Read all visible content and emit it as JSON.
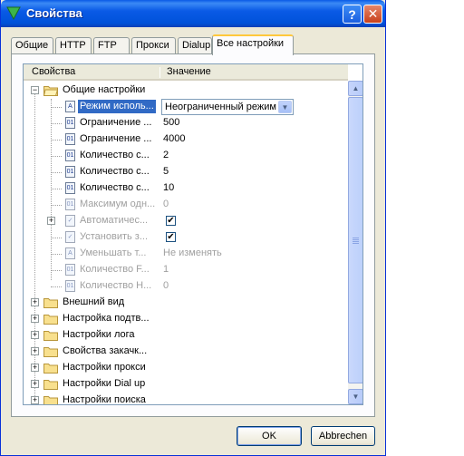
{
  "window": {
    "title": "Свойства",
    "icon": "v-triangle-icon"
  },
  "title_buttons": {
    "help": "?",
    "close": "✕"
  },
  "tabs": [
    {
      "label": "Общие",
      "active": false
    },
    {
      "label": "HTTP",
      "active": false
    },
    {
      "label": "FTP",
      "active": false
    },
    {
      "label": "Прокси",
      "active": false
    },
    {
      "label": "Dialup",
      "active": false
    },
    {
      "label": "Все настройки",
      "active": true
    }
  ],
  "grid": {
    "col_property": "Свойства",
    "col_value": "Значение",
    "rows": [
      {
        "label": "Общие настройки",
        "value": "",
        "kind": "group-open"
      },
      {
        "label": "Режим исполь...",
        "value": "Неограниченный режим",
        "kind": "dropdown"
      },
      {
        "label": "Ограничение ...",
        "value": "500",
        "kind": "num"
      },
      {
        "label": "Ограничение ...",
        "value": "4000",
        "kind": "num"
      },
      {
        "label": "Количество с...",
        "value": "2",
        "kind": "num"
      },
      {
        "label": "Количество с...",
        "value": "5",
        "kind": "num"
      },
      {
        "label": "Количество с...",
        "value": "10",
        "kind": "num"
      },
      {
        "label": "Максимум одн...",
        "value": "0",
        "kind": "num-disabled"
      },
      {
        "label": "Автоматичес...",
        "value": "checked",
        "kind": "bool-disabled-expandable"
      },
      {
        "label": "Установить з...",
        "value": "checked",
        "kind": "bool-disabled"
      },
      {
        "label": "Уменьшать т...",
        "value": "Не изменять",
        "kind": "text-disabled"
      },
      {
        "label": "Количество F...",
        "value": "1",
        "kind": "num-disabled"
      },
      {
        "label": "Количество Н...",
        "value": "0",
        "kind": "num-disabled"
      },
      {
        "label": "Внешний вид",
        "value": "",
        "kind": "group"
      },
      {
        "label": "Настройка подтв...",
        "value": "",
        "kind": "group"
      },
      {
        "label": "Настройки лога",
        "value": "",
        "kind": "group"
      },
      {
        "label": "Свойства закачк...",
        "value": "",
        "kind": "group"
      },
      {
        "label": "Настройки прокси",
        "value": "",
        "kind": "group"
      },
      {
        "label": "Настройки Dial up",
        "value": "",
        "kind": "group"
      },
      {
        "label": "Настройки поиска",
        "value": "",
        "kind": "group"
      }
    ]
  },
  "buttons": {
    "ok": "OK",
    "cancel": "Abbrechen"
  },
  "colors": {
    "titlebar": "#0a5ae6",
    "selection": "#316ac5",
    "active_tab_accent": "#ffc83c"
  }
}
